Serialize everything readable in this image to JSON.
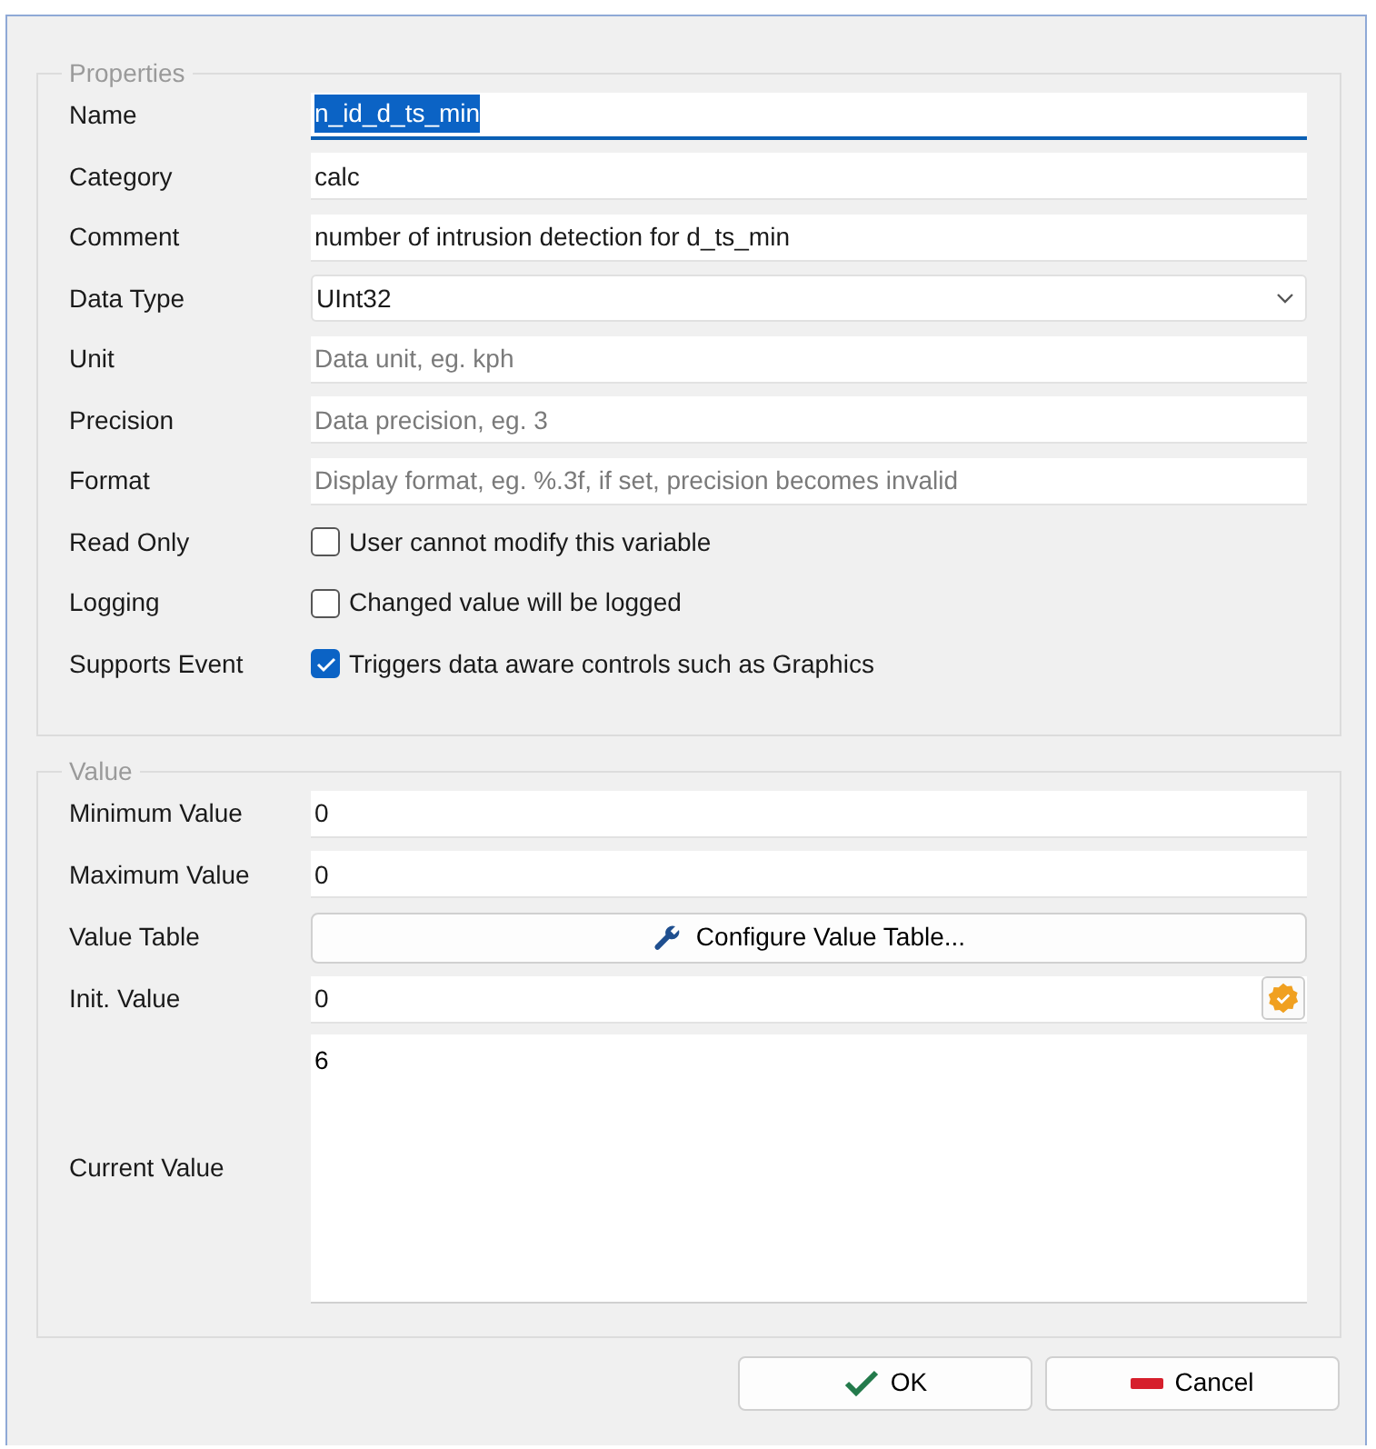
{
  "properties": {
    "title": "Properties",
    "fields": [
      {
        "kind": "text",
        "label": "Name",
        "value": "n_id_d_ts_min",
        "focused": true
      },
      {
        "kind": "text",
        "label": "Category",
        "value": "calc",
        "focused": false
      },
      {
        "kind": "text",
        "label": "Comment",
        "value": "number of intrusion detection for d_ts_min",
        "focused": false
      },
      {
        "kind": "select",
        "label": "Data Type",
        "value": "UInt32"
      },
      {
        "kind": "text",
        "label": "Unit",
        "placeholder": "Data unit, eg. kph",
        "focused": false
      },
      {
        "kind": "text",
        "label": "Precision",
        "placeholder": "Data precision, eg. 3",
        "focused": false
      },
      {
        "kind": "text",
        "label": "Format",
        "placeholder": "Display format, eg. %.3f, if set, precision becomes invalid",
        "focused": false
      },
      {
        "kind": "checkbox",
        "label": "Read Only",
        "text": "User cannot modify this variable",
        "checked": false
      },
      {
        "kind": "checkbox",
        "label": "Logging",
        "text": "Changed value will be logged",
        "checked": false
      },
      {
        "kind": "checkbox",
        "label": "Supports Event",
        "text": "Triggers data aware controls such as Graphics",
        "checked": true
      }
    ]
  },
  "value": {
    "title": "Value",
    "fields": [
      {
        "kind": "text",
        "label": "Minimum Value",
        "value": "0",
        "focused": false
      },
      {
        "kind": "text",
        "label": "Maximum Value",
        "value": "0",
        "focused": false
      },
      {
        "kind": "button",
        "label": "Value Table",
        "text": "Configure Value Table..."
      },
      {
        "kind": "badge-text",
        "label": "Init. Value",
        "value": "0",
        "focused": false
      },
      {
        "kind": "textarea",
        "label": "Current Value",
        "value": "6"
      }
    ]
  },
  "buttons": [
    {
      "kind": "ok",
      "text": "OK"
    },
    {
      "kind": "cancel",
      "text": "Cancel"
    }
  ]
}
